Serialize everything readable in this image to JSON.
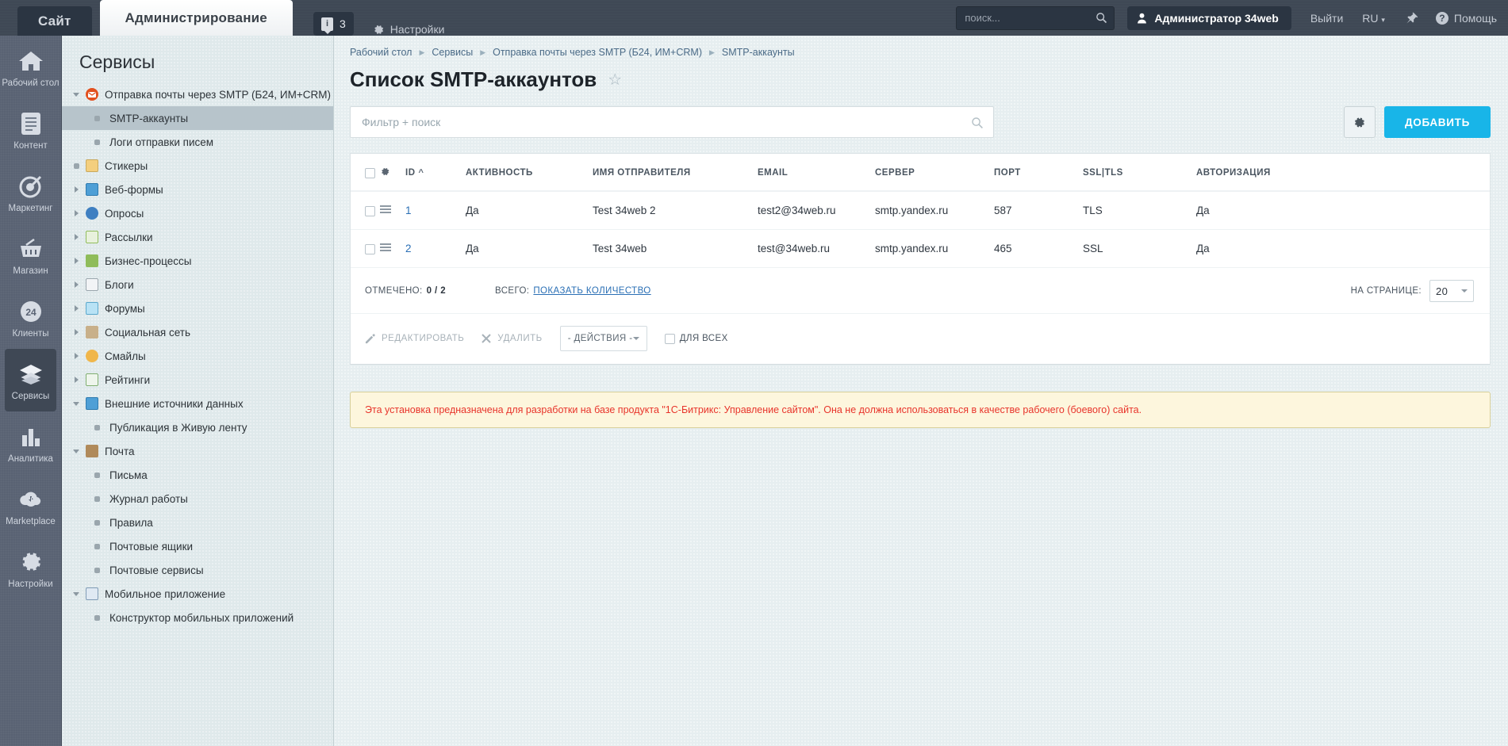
{
  "topbar": {
    "tab_site": "Сайт",
    "tab_admin": "Администрирование",
    "counter_value": "3",
    "counter_icon": "info-badge-icon",
    "settings_label": "Настройки",
    "search_placeholder": "поиск...",
    "search_value": "",
    "user_name": "Администратор 34web",
    "logout_label": "Выйти",
    "language": "RU",
    "pin_icon": "pin-icon",
    "help_label": "Помощь"
  },
  "rail": {
    "items": [
      {
        "label": "Рабочий стол",
        "icon": "home-icon",
        "active": false
      },
      {
        "label": "Контент",
        "icon": "document-icon",
        "active": false
      },
      {
        "label": "Маркетинг",
        "icon": "target-icon",
        "active": false
      },
      {
        "label": "Магазин",
        "icon": "basket-icon",
        "active": false
      },
      {
        "label": "Клиенты",
        "icon": "circle-24-icon",
        "active": false
      },
      {
        "label": "Сервисы",
        "icon": "layers-icon",
        "active": true
      },
      {
        "label": "Аналитика",
        "icon": "bar-chart-icon",
        "active": false
      },
      {
        "label": "Marketplace",
        "icon": "cloud-download-icon",
        "active": false
      },
      {
        "label": "Настройки",
        "icon": "gear-icon",
        "active": false
      }
    ]
  },
  "tree": {
    "title": "Сервисы",
    "nodes": [
      {
        "label": "Отправка почты через SMTP (Б24, ИМ+CRM)",
        "type": "group",
        "state": "open",
        "icon": "mail-red-icon",
        "color": "#e2501e"
      },
      {
        "label": "SMTP-аккаунты",
        "type": "leaf",
        "selected": true
      },
      {
        "label": "Логи отправки писем",
        "type": "leaf",
        "selected": false
      },
      {
        "label": "Стикеры",
        "type": "group",
        "state": "dot",
        "icon": "sticker-icon",
        "color": "#f4cf7e"
      },
      {
        "label": "Веб-формы",
        "type": "group",
        "state": "closed",
        "icon": "webform-icon",
        "color": "#4e9fd6"
      },
      {
        "label": "Опросы",
        "type": "group",
        "state": "closed",
        "icon": "pie-icon",
        "color": "#3e7fc1"
      },
      {
        "label": "Рассылки",
        "type": "group",
        "state": "closed",
        "icon": "newsletter-icon",
        "color": "#9ec97a"
      },
      {
        "label": "Бизнес-процессы",
        "type": "group",
        "state": "closed",
        "icon": "workflow-icon",
        "color": "#8fbc5a"
      },
      {
        "label": "Блоги",
        "type": "group",
        "state": "closed",
        "icon": "blog-pencil-icon",
        "color": "#d4d7da"
      },
      {
        "label": "Форумы",
        "type": "group",
        "state": "closed",
        "icon": "forum-icon",
        "color": "#7fc6e8"
      },
      {
        "label": "Социальная сеть",
        "type": "group",
        "state": "closed",
        "icon": "people-icon",
        "color": "#c8b08a"
      },
      {
        "label": "Смайлы",
        "type": "group",
        "state": "closed",
        "icon": "smiley-icon",
        "color": "#f0b64a"
      },
      {
        "label": "Рейтинги",
        "type": "group",
        "state": "closed",
        "icon": "rating-plus-icon",
        "color": "#cfe0cc"
      },
      {
        "label": "Внешние источники данных",
        "type": "group",
        "state": "open",
        "icon": "rss-icon",
        "color": "#4e9fd6"
      },
      {
        "label": "Публикация в Живую ленту",
        "type": "leaf",
        "selected": false
      },
      {
        "label": "Почта",
        "type": "group",
        "state": "open",
        "icon": "mailbox-icon",
        "color": "#b08a5a"
      },
      {
        "label": "Письма",
        "type": "leaf",
        "selected": false
      },
      {
        "label": "Журнал работы",
        "type": "leaf",
        "selected": false
      },
      {
        "label": "Правила",
        "type": "leaf",
        "selected": false
      },
      {
        "label": "Почтовые ящики",
        "type": "leaf",
        "selected": false
      },
      {
        "label": "Почтовые сервисы",
        "type": "leaf",
        "selected": false
      },
      {
        "label": "Мобильное приложение",
        "type": "group",
        "state": "open",
        "icon": "mobile-icon",
        "color": "#a8c4dc"
      },
      {
        "label": "Конструктор мобильных приложений",
        "type": "leaf",
        "selected": false
      }
    ]
  },
  "breadcrumbs": [
    "Рабочий стол",
    "Сервисы",
    "Отправка почты через SMTP (Б24, ИМ+CRM)",
    "SMTP-аккаунты"
  ],
  "page": {
    "title": "Список SMTP-аккаунтов",
    "favorite_icon": "star-icon"
  },
  "filter": {
    "placeholder": "Фильтр + поиск",
    "value": "",
    "search_icon": "search-icon"
  },
  "actions": {
    "settings_icon": "gear-icon",
    "add_label": "ДОБАВИТЬ",
    "add_color": "#18b5e8"
  },
  "grid": {
    "columns": [
      "ID",
      "АКТИВНОСТЬ",
      "ИМЯ ОТПРАВИТЕЛЯ",
      "EMAIL",
      "СЕРВЕР",
      "ПОРТ",
      "SSL|TLS",
      "АВТОРИЗАЦИЯ"
    ],
    "sort_column": "ID",
    "sort_direction": "asc",
    "rows": [
      {
        "id": "1",
        "active": "Да",
        "sender_name": "Test 34web 2",
        "email": "test2@34web.ru",
        "server": "smtp.yandex.ru",
        "port": "587",
        "ssl": "TLS",
        "auth": "Да",
        "checked": false
      },
      {
        "id": "2",
        "active": "Да",
        "sender_name": "Test 34web",
        "email": "test@34web.ru",
        "server": "smtp.yandex.ru",
        "port": "465",
        "ssl": "SSL",
        "auth": "Да",
        "checked": false
      }
    ],
    "footer": {
      "checked_label": "ОТМЕЧЕНО:",
      "checked_value": "0 / 2",
      "total_label": "ВСЕГО:",
      "total_link": "ПОКАЗАТЬ КОЛИЧЕСТВО",
      "perpage_label": "НА СТРАНИЦЕ:",
      "perpage_value": "20"
    },
    "tools": {
      "edit_label": "РЕДАКТИРОВАТЬ",
      "delete_label": "УДАЛИТЬ",
      "actions_label": "- ДЕЙСТВИЯ -",
      "forall_label": "ДЛЯ ВСЕХ"
    }
  },
  "warning": {
    "text": "Эта установка предназначена для разработки на базе продукта \"1С-Битрикс: Управление сайтом\". Она не должна использоваться в качестве рабочего (боевого) сайта.",
    "color": "#e8342b"
  }
}
